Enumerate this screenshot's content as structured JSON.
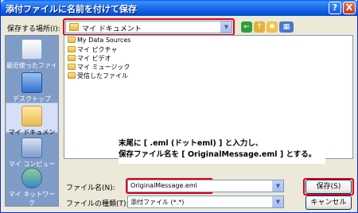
{
  "window": {
    "title": "添付ファイルに名前を付けて保存",
    "help_label": "?",
    "close_label": "X"
  },
  "location": {
    "label": "保存する場所(I):",
    "value": "マイ ドキュメント"
  },
  "places": [
    {
      "label": "最近使ったファイル"
    },
    {
      "label": "デスクトップ"
    },
    {
      "label": "マイ ドキュメント"
    },
    {
      "label": "マイ コンピュータ"
    },
    {
      "label": "マイ ネットワーク"
    }
  ],
  "files": [
    {
      "name": "My Data Sources"
    },
    {
      "name": "マイ ピクチャ"
    },
    {
      "name": "マイ ビデオ"
    },
    {
      "name": "マイ ミュージック"
    },
    {
      "name": "受信したファイル"
    }
  ],
  "callout": {
    "line1": "末尾に [ .eml (ドットeml) ] と入力し、",
    "line2": "保存ファイル名を [ OriginalMessage.eml ] とする。"
  },
  "filename": {
    "label": "ファイル名(N):",
    "value": "OriginalMessage.eml"
  },
  "filetype": {
    "label": "ファイルの種類(T):",
    "value": "添付ファイル (*.*)"
  },
  "buttons": {
    "save": "保存(S)",
    "cancel": "キャンセル"
  },
  "colors": {
    "highlight_red": "#e0001a",
    "titlebar_blue": "#0757e0",
    "places_bar": "#7f9cc7"
  }
}
